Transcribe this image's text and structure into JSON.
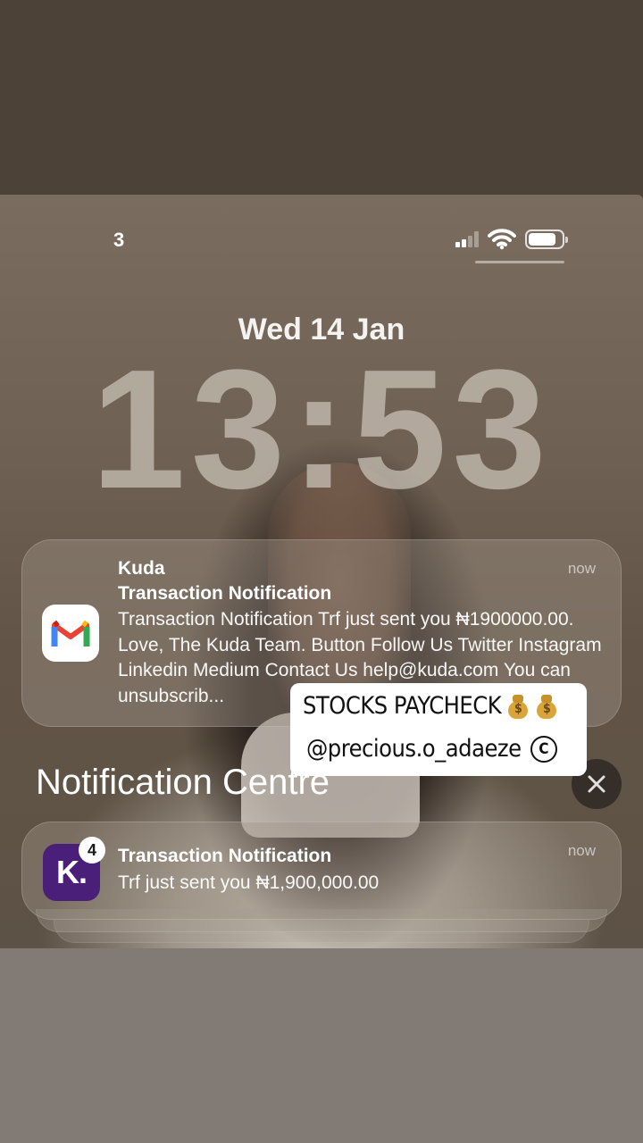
{
  "status_bar": {
    "carrier": "3"
  },
  "lock_screen": {
    "date": "Wed 14 Jan",
    "time": "13:53"
  },
  "notification_top": {
    "app": "Kuda",
    "title": "Transaction Notification",
    "body": "Transaction Notification Trf just sent you ₦1900000.00. Love, The Kuda Team. Button Follow Us Twitter Instagram Linkedin Medium Contact Us help@kuda.com You can unsubscrib...",
    "time": "now",
    "icon": "gmail-icon"
  },
  "notification_centre": {
    "heading": "Notification Centre",
    "close_icon": "close-icon"
  },
  "notification_kuda": {
    "badge": "4",
    "icon_letter": "K.",
    "title": "Transaction Notification",
    "body": "Trf just sent you ₦1,900,000.00",
    "time": "now"
  },
  "sticker": {
    "line1": "STOCKS PAYCHECK",
    "line2": "@precious.o_adaeze",
    "mark": "C"
  },
  "colors": {
    "kuda_purple": "#4a1f7a",
    "gmail_red": "#ea4335"
  }
}
